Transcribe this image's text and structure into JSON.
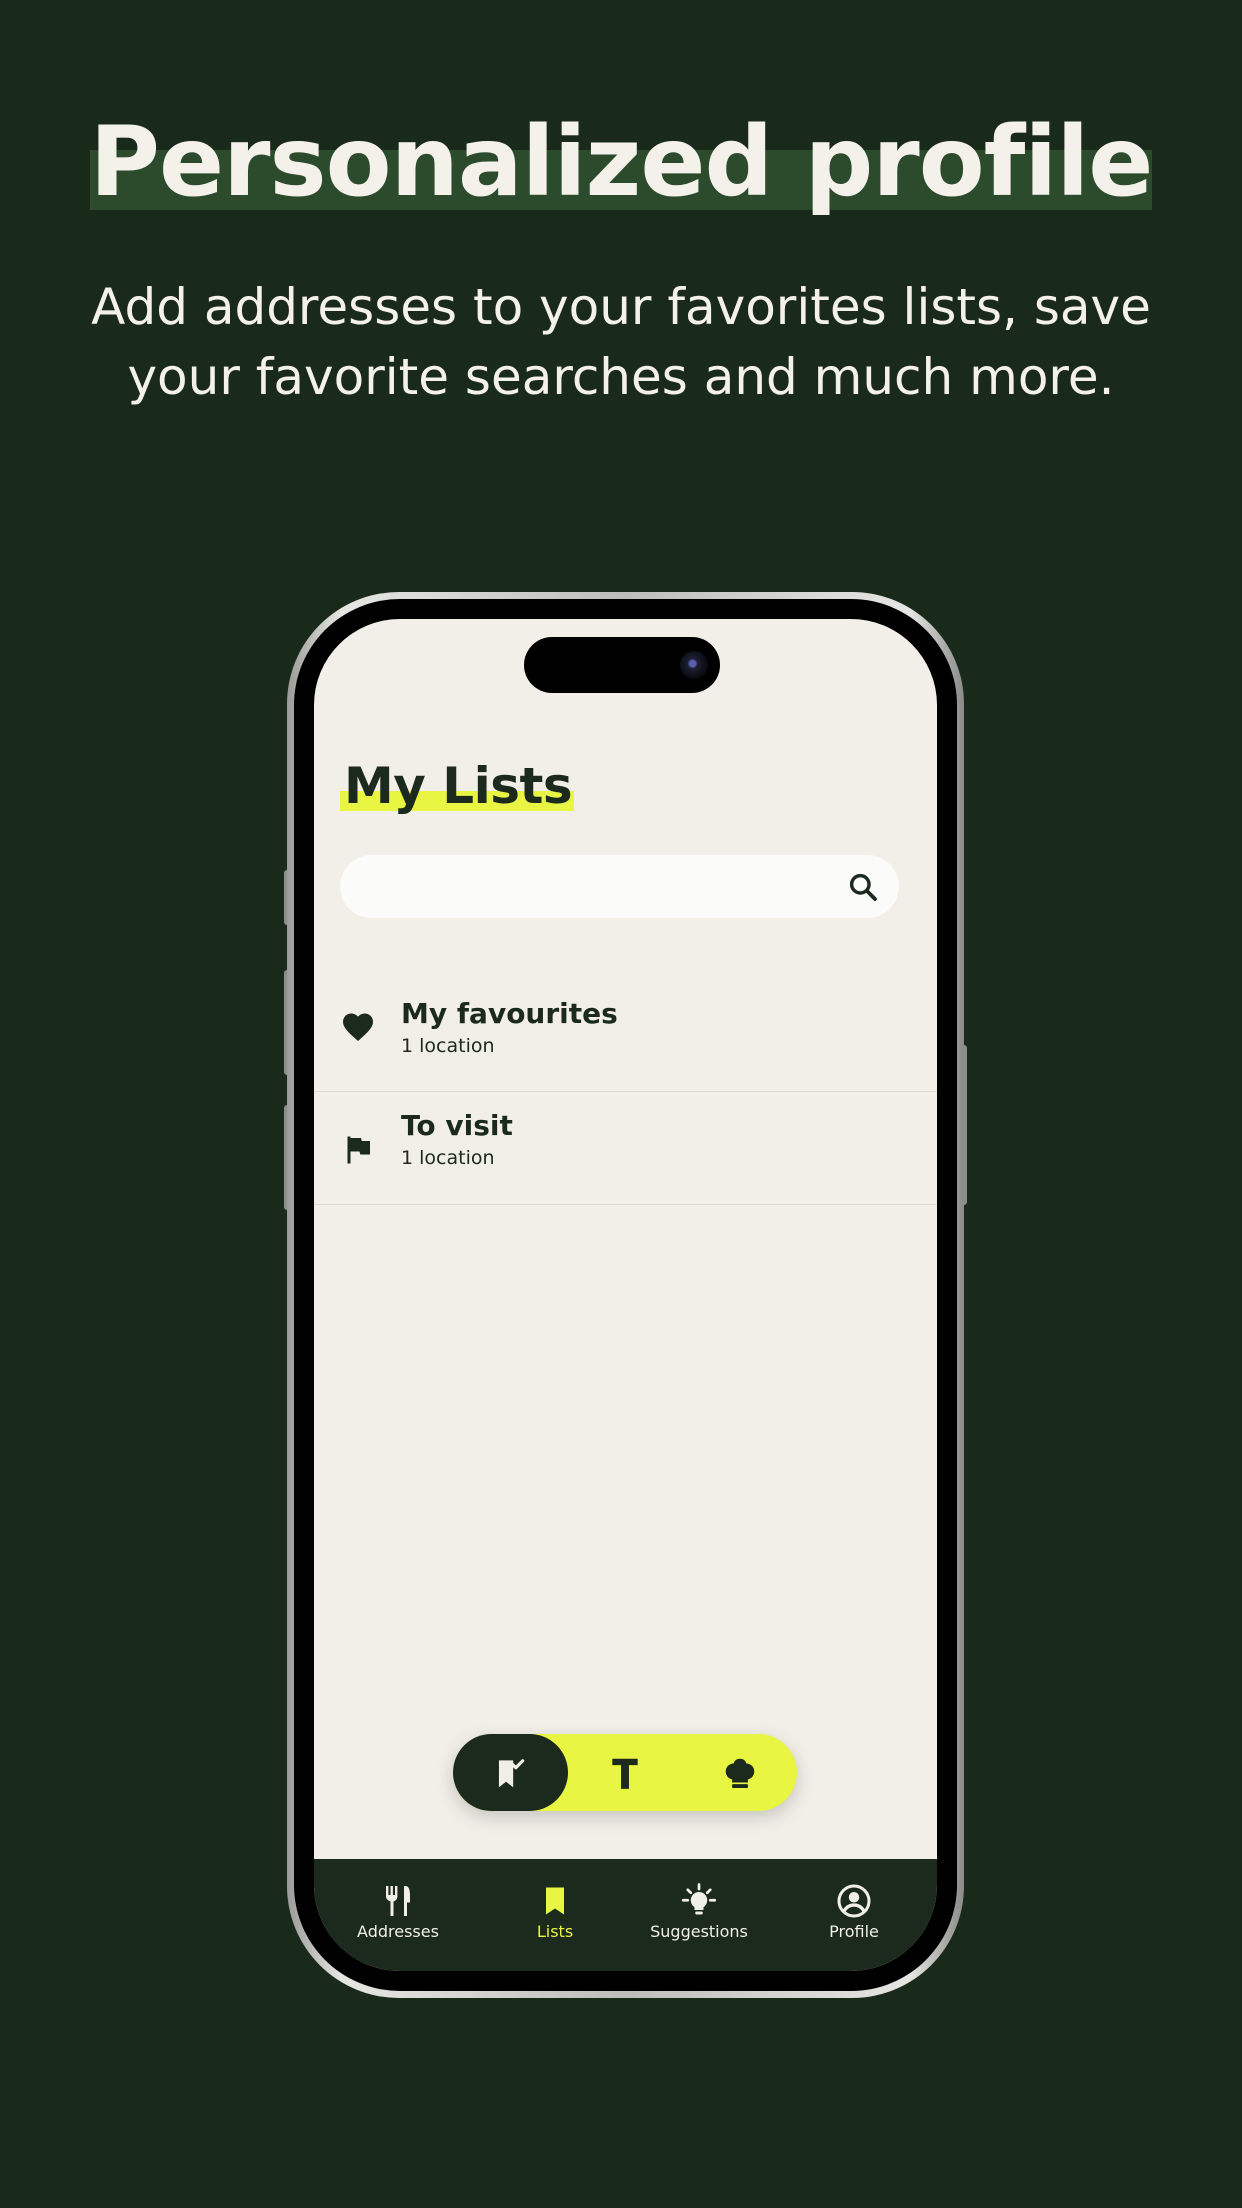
{
  "promo": {
    "headline": "Personalized profile",
    "subtitle": "Add addresses to your favorites lists, save your favorite searches and much more."
  },
  "screen": {
    "title": "My Lists",
    "search": {
      "placeholder": "",
      "value": ""
    },
    "lists": [
      {
        "name": "My favourites",
        "count": "1 location",
        "icon": "heart-icon"
      },
      {
        "name": "To visit",
        "count": "1 location",
        "icon": "flag-icon"
      }
    ],
    "toggle": {
      "options": [
        "bookmark-check-icon",
        "text-t-icon",
        "chef-hat-icon"
      ],
      "active_index": 0
    },
    "tabbar": {
      "tabs": [
        {
          "label": "Addresses",
          "icon": "fork-knife-icon"
        },
        {
          "label": "Lists",
          "icon": "bookmark-icon"
        },
        {
          "label": "Suggestions",
          "icon": "lightbulb-icon"
        },
        {
          "label": "Profile",
          "icon": "user-circle-icon"
        }
      ],
      "active_index": 1
    }
  },
  "colors": {
    "background": "#1a2a1a",
    "accent": "#e8f542",
    "dark": "#1b2a1c",
    "screen_bg": "#f2efe8"
  }
}
